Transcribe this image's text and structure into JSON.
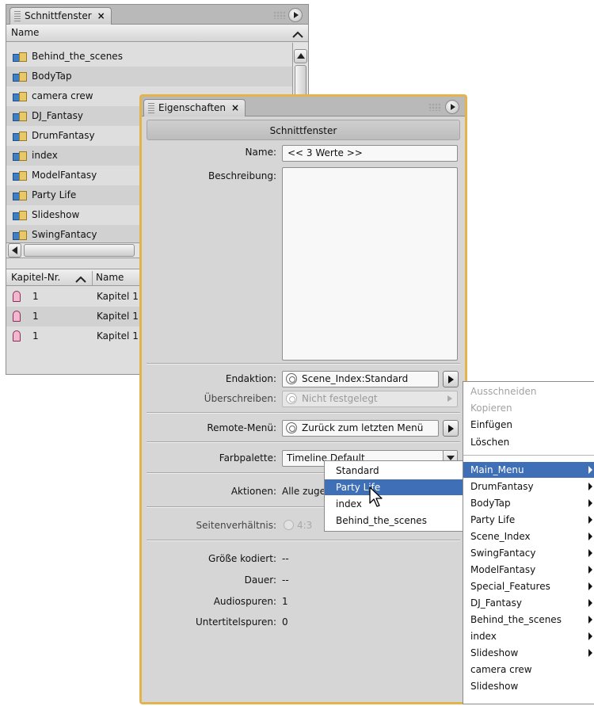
{
  "timeline_panel": {
    "tab_label": "Schnittfenster",
    "close_glyph": "×",
    "column_name": "Name",
    "items": [
      "Behind_the_scenes",
      "BodyTap",
      "camera crew",
      "DJ_Fantasy",
      "DrumFantasy",
      "index",
      "ModelFantasy",
      "Party Life",
      "Slideshow",
      "SwingFantacy"
    ],
    "chapter_headers": {
      "number": "Kapitel-Nr.",
      "name": "Name"
    },
    "chapters": [
      {
        "number": "1",
        "name": "Kapitel 1"
      },
      {
        "number": "1",
        "name": "Kapitel 1"
      },
      {
        "number": "1",
        "name": "Kapitel 1"
      }
    ]
  },
  "properties_panel": {
    "tab_label": "Eigenschaften",
    "close_glyph": "×",
    "section_title": "Schnittfenster",
    "name_label": "Name:",
    "name_value": "<< 3 Werte >>",
    "description_label": "Beschreibung:",
    "description_value": "",
    "end_action_label": "Endaktion:",
    "end_action_value": "Scene_Index:Standard",
    "override_label": "Überschreiben:",
    "override_value": "Nicht festgelegt",
    "remote_menu_label": "Remote-Menü:",
    "remote_menu_value": "Zurück zum letzten Menü",
    "palette_label": "Farbpalette:",
    "palette_value": "Timeline Default",
    "actions_label": "Aktionen:",
    "actions_value": "Alle zuge",
    "aspect_label": "Seitenverhältnis:",
    "aspect_value": "4:3",
    "encoded_size_label": "Größe kodiert:",
    "encoded_size_value": "--",
    "duration_label": "Dauer:",
    "duration_value": "--",
    "audio_tracks_label": "Audiospuren:",
    "audio_tracks_value": "1",
    "subtitle_tracks_label": "Untertitelspuren:",
    "subtitle_tracks_value": "0"
  },
  "context_menu": {
    "edit_items": [
      {
        "label": "Ausschneiden",
        "enabled": false
      },
      {
        "label": "Kopieren",
        "enabled": false
      },
      {
        "label": "Einfügen",
        "enabled": true
      },
      {
        "label": "Löschen",
        "enabled": true
      }
    ],
    "menus": [
      {
        "label": "Main_Menu",
        "submenu": true,
        "selected": true
      },
      {
        "label": "DrumFantasy",
        "submenu": true
      },
      {
        "label": "BodyTap",
        "submenu": true
      },
      {
        "label": "Party Life",
        "submenu": true
      },
      {
        "label": "Scene_Index",
        "submenu": true
      },
      {
        "label": "SwingFantacy",
        "submenu": true
      },
      {
        "label": "ModelFantasy",
        "submenu": true
      },
      {
        "label": "Special_Features",
        "submenu": true
      },
      {
        "label": "DJ_Fantasy",
        "submenu": true
      },
      {
        "label": "Behind_the_scenes",
        "submenu": true
      },
      {
        "label": "index",
        "submenu": true
      },
      {
        "label": "Slideshow",
        "submenu": true
      },
      {
        "label": "camera crew",
        "submenu": false
      },
      {
        "label": "Slideshow",
        "submenu": false
      }
    ]
  },
  "submenu": {
    "items": [
      "Standard",
      "Party Life",
      "index",
      "Behind_the_scenes"
    ],
    "selected": "Party Life"
  },
  "colors": {
    "panel_bg": "#dedede",
    "active_panel_border": "#e3b44b",
    "selection": "#3f6fb6"
  }
}
